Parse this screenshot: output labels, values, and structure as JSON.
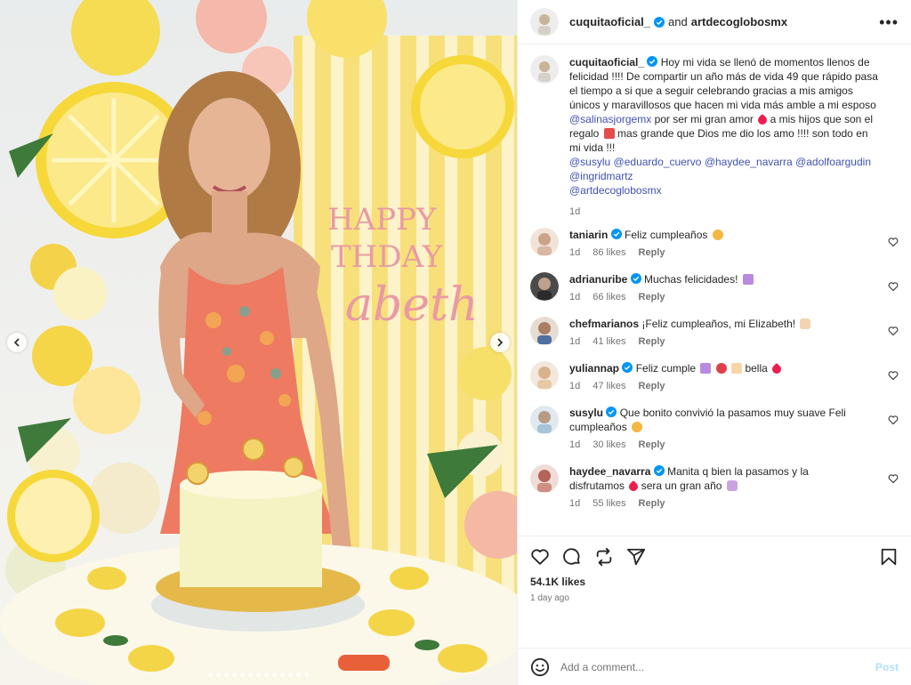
{
  "header": {
    "author": "cuquitaoficial_",
    "and_text": "and",
    "collaborator": "artdecoglobosmx",
    "more": "•••"
  },
  "caption": {
    "author": "cuquitaoficial_",
    "text_1": "Hoy mi vida se llenó de momentos llenos de felicidad !!!! De compartir un año más de vida 49 que rápido pasa el tiempo a si que a seguir celebrando gracias a mis amigos únicos y maravillosos que hacen mi vida más amble a mi esposo",
    "mention_1": "@salinasjorgemx",
    "text_2": "por ser mi gran amor",
    "text_3": "a mis hijos que son el regalo",
    "text_4": "mas grande que Dios me dio los amo !!!! son todo en mi vida !!!",
    "mention_2": "@susylu",
    "mention_3": "@eduardo_cuervo",
    "mention_4": "@haydee_navarra",
    "mention_5": "@adolfoargudin",
    "mention_6": "@ingridmartz",
    "mention_7": "@artdecoglobosmx",
    "time": "1d"
  },
  "comments": [
    {
      "user": "taniarin",
      "text": "Feliz cumpleaños",
      "time": "1d",
      "likes": "86 likes",
      "reply": "Reply",
      "avatar_color": "#c9a48a"
    },
    {
      "user": "adrianuribe",
      "text": "Muchas felicidades!",
      "time": "1d",
      "likes": "66 likes",
      "reply": "Reply",
      "avatar_color": "#3b3b3b"
    },
    {
      "user": "chefmarianos",
      "text": "¡Feliz cumpleaños, mi Elizabeth!",
      "time": "1d",
      "likes": "41 likes",
      "reply": "Reply",
      "avatar_color": "#8a6a55"
    },
    {
      "user": "yuliannap",
      "text_a": "Feliz cumple",
      "text_b": "bella",
      "time": "1d",
      "likes": "47 likes",
      "reply": "Reply",
      "avatar_color": "#d9b28c"
    },
    {
      "user": "susylu",
      "text": "Que bonito convivió la pasamos muy suave Feli cumpleaños",
      "time": "1d",
      "likes": "30 likes",
      "reply": "Reply",
      "avatar_color": "#a7c4d6"
    },
    {
      "user": "haydee_navarra",
      "text_a": "Manita q bien la pasamos y la disfrutamos",
      "text_b": "sera un gran año",
      "time": "1d",
      "likes": "55 likes",
      "reply": "Reply",
      "avatar_color": "#b5645a"
    }
  ],
  "actions": {
    "likes": "54.1K likes",
    "date": "1 day ago"
  },
  "composer": {
    "placeholder": "Add a comment...",
    "post": "Post"
  },
  "image_text": {
    "line1": "HAPPY",
    "line2": "THDAY",
    "line3": "abeth"
  },
  "colors": {
    "verified": "#0095f6",
    "heart": "#ed1d4d",
    "link": "#3f51b5"
  }
}
